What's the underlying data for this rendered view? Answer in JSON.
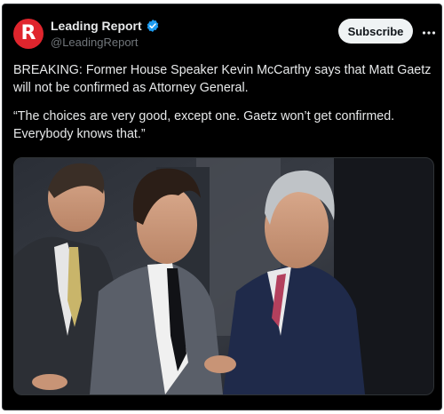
{
  "account": {
    "name": "Leading Report",
    "handle": "@LeadingReport",
    "avatar_letter": "R",
    "verified": true,
    "brand_color": "#e0252d",
    "verified_color": "#1d9bf0"
  },
  "actions": {
    "subscribe_label": "Subscribe",
    "more_icon": "more-horizontal-icon"
  },
  "tweet": {
    "line1": "BREAKING: Former House Speaker Kevin McCarthy says that Matt Gaetz will not be confirmed as Attorney General.",
    "line2": "“The choices are very good, except one. Gaetz won’t get confirmed. Everybody knows that.”"
  },
  "media": {
    "type": "photo"
  }
}
